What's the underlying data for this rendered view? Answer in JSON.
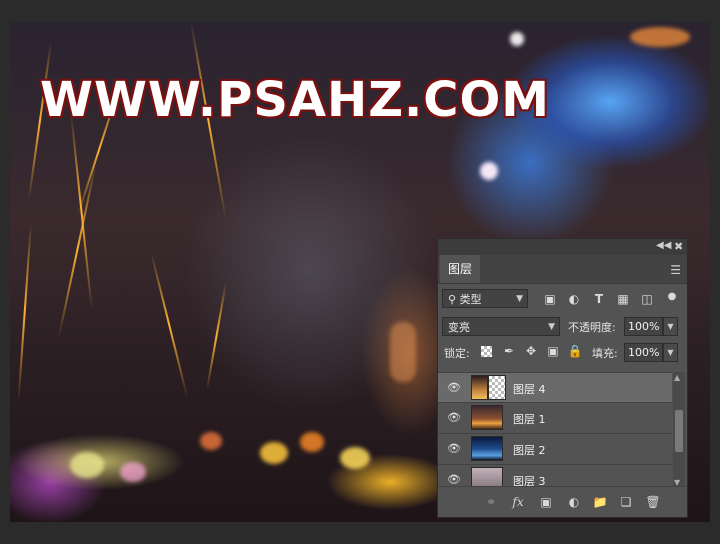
{
  "watermark": "WWW.PSAHZ.COM",
  "panel": {
    "collapse_icon": "double-chevron-icon",
    "close_icon": "close-icon",
    "tab_label": "图层",
    "menu_icon": "hamburger-menu-icon",
    "filter": {
      "kind_label": "类型",
      "icons": [
        "image-filter-icon",
        "adjustment-filter-icon",
        "text-filter-icon",
        "shape-filter-icon",
        "smart-object-filter-icon",
        "filter-toggle-icon"
      ]
    },
    "blend_mode": "变亮",
    "opacity_label": "不透明度:",
    "opacity_value": "100%",
    "lock_label": "锁定:",
    "lock_icons": [
      "lock-transparent-pixels-icon",
      "lock-image-pixels-icon",
      "lock-position-icon",
      "lock-artboard-icon",
      "lock-all-icon"
    ],
    "fill_label": "填充:",
    "fill_value": "100%",
    "layers": [
      {
        "name": "图层 4",
        "selected": true,
        "thumb": "flower-sparks-with-mask"
      },
      {
        "name": "图层 1",
        "selected": false,
        "thumb": "city-night"
      },
      {
        "name": "图层 2",
        "selected": false,
        "thumb": "blue-night"
      },
      {
        "name": "图层 3",
        "selected": false,
        "thumb": "portrait"
      }
    ],
    "bottom_icons": [
      "link-layers-icon",
      "fx-icon",
      "add-mask-icon",
      "adjustment-layer-icon",
      "new-group-icon",
      "new-layer-icon",
      "delete-icon"
    ],
    "fx_label": "fx"
  }
}
